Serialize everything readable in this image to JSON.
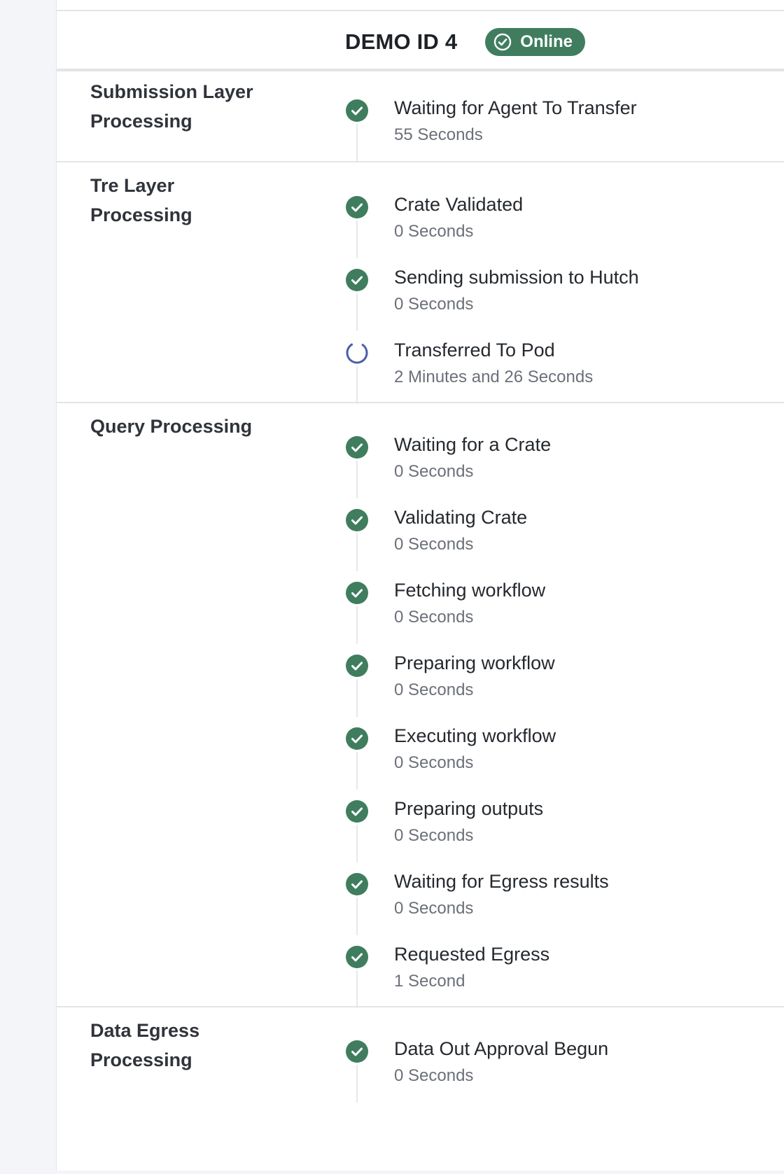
{
  "header": {
    "title": "DEMO ID 4",
    "status": "Online"
  },
  "colors": {
    "success": "#3f7d5e",
    "pending": "#4a5fa8"
  },
  "sections": [
    {
      "title": "Submission Layer Processing",
      "steps": [
        {
          "label": "Waiting for Agent To Transfer",
          "duration": "55 Seconds",
          "state": "done"
        }
      ]
    },
    {
      "title": "Tre Layer Processing",
      "steps": [
        {
          "label": "Crate Validated",
          "duration": "0 Seconds",
          "state": "done"
        },
        {
          "label": "Sending submission to Hutch",
          "duration": "0 Seconds",
          "state": "done"
        },
        {
          "label": "Transferred To Pod",
          "duration": "2 Minutes and 26 Seconds",
          "state": "pending"
        }
      ]
    },
    {
      "title": "Query Processing",
      "steps": [
        {
          "label": "Waiting for a Crate",
          "duration": "0 Seconds",
          "state": "done"
        },
        {
          "label": "Validating Crate",
          "duration": "0 Seconds",
          "state": "done"
        },
        {
          "label": "Fetching workflow",
          "duration": "0 Seconds",
          "state": "done"
        },
        {
          "label": "Preparing workflow",
          "duration": "0 Seconds",
          "state": "done"
        },
        {
          "label": "Executing workflow",
          "duration": "0 Seconds",
          "state": "done"
        },
        {
          "label": "Preparing outputs",
          "duration": "0 Seconds",
          "state": "done"
        },
        {
          "label": "Waiting for Egress results",
          "duration": "0 Seconds",
          "state": "done"
        },
        {
          "label": "Requested Egress",
          "duration": "1 Second",
          "state": "done"
        }
      ]
    },
    {
      "title": "Data Egress Processing",
      "steps": [
        {
          "label": "Data Out Approval Begun",
          "duration": "0 Seconds",
          "state": "done"
        }
      ]
    }
  ]
}
